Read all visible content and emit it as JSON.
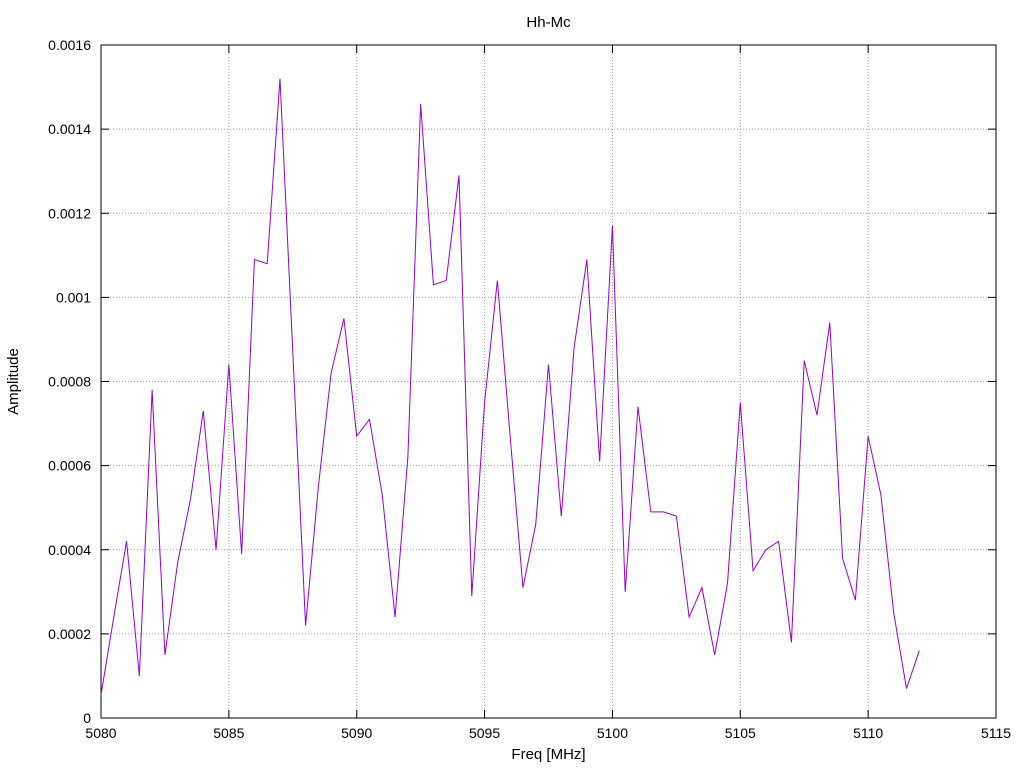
{
  "chart_data": {
    "type": "line",
    "title": "Hh-Mc",
    "xlabel": "Freq [MHz]",
    "ylabel": "Amplitude",
    "xlim": [
      5080,
      5115
    ],
    "ylim": [
      0,
      0.0016
    ],
    "xticks": [
      "5080",
      "5085",
      "5090",
      "5095",
      "5100",
      "5105",
      "5110",
      "5115"
    ],
    "xtick_values": [
      5080,
      5085,
      5090,
      5095,
      5100,
      5105,
      5110,
      5115
    ],
    "yticks": [
      "0",
      "0.0002",
      "0.0004",
      "0.0006",
      "0.0008",
      "0.001",
      "0.0012",
      "0.0014",
      "0.0016"
    ],
    "ytick_values": [
      0,
      0.0002,
      0.0004,
      0.0006,
      0.0008,
      0.001,
      0.0012,
      0.0014,
      0.0016
    ],
    "grid": true,
    "series": [
      {
        "color": "#9400d3",
        "x": [
          5080,
          5080.5,
          5081,
          5081.5,
          5082,
          5082.5,
          5083,
          5083.5,
          5084,
          5084.5,
          5085,
          5085.5,
          5086,
          5086.5,
          5087,
          5087.5,
          5088,
          5088.5,
          5089,
          5089.5,
          5090,
          5090.5,
          5091,
          5091.5,
          5092,
          5092.5,
          5093,
          5093.5,
          5094,
          5094.5,
          5095,
          5095.5,
          5096,
          5096.5,
          5097,
          5097.5,
          5098,
          5098.5,
          5099,
          5099.5,
          5100,
          5100.5,
          5101,
          5101.5,
          5102,
          5102.5,
          5103,
          5103.5,
          5104,
          5104.5,
          5105,
          5105.5,
          5106,
          5106.5,
          5107,
          5107.5,
          5108,
          5108.5,
          5109,
          5109.5,
          5110,
          5110.5,
          5111,
          5111.5,
          5112
        ],
        "y": [
          5.5e-05,
          0.00024,
          0.00042,
          0.0001,
          0.00078,
          0.00015,
          0.00037,
          0.00052,
          0.00073,
          0.0004,
          0.00084,
          0.00039,
          0.00109,
          0.00108,
          0.00152,
          0.00087,
          0.00022,
          0.00055,
          0.00082,
          0.00095,
          0.00067,
          0.00071,
          0.00053,
          0.00024,
          0.00062,
          0.00146,
          0.00103,
          0.00104,
          0.00129,
          0.00029,
          0.00075,
          0.00104,
          0.00067,
          0.00031,
          0.00046,
          0.00084,
          0.00048,
          0.00088,
          0.00109,
          0.00061,
          0.00117,
          0.0003,
          0.00074,
          0.00049,
          0.00049,
          0.00048,
          0.00024,
          0.00031,
          0.00015,
          0.00032,
          0.00075,
          0.00035,
          0.0004,
          0.00042,
          0.00018,
          0.00085,
          0.00072,
          0.00094,
          0.00038,
          0.00028,
          0.00067,
          0.00053,
          0.00025,
          7e-05,
          0.00016
        ]
      }
    ]
  }
}
